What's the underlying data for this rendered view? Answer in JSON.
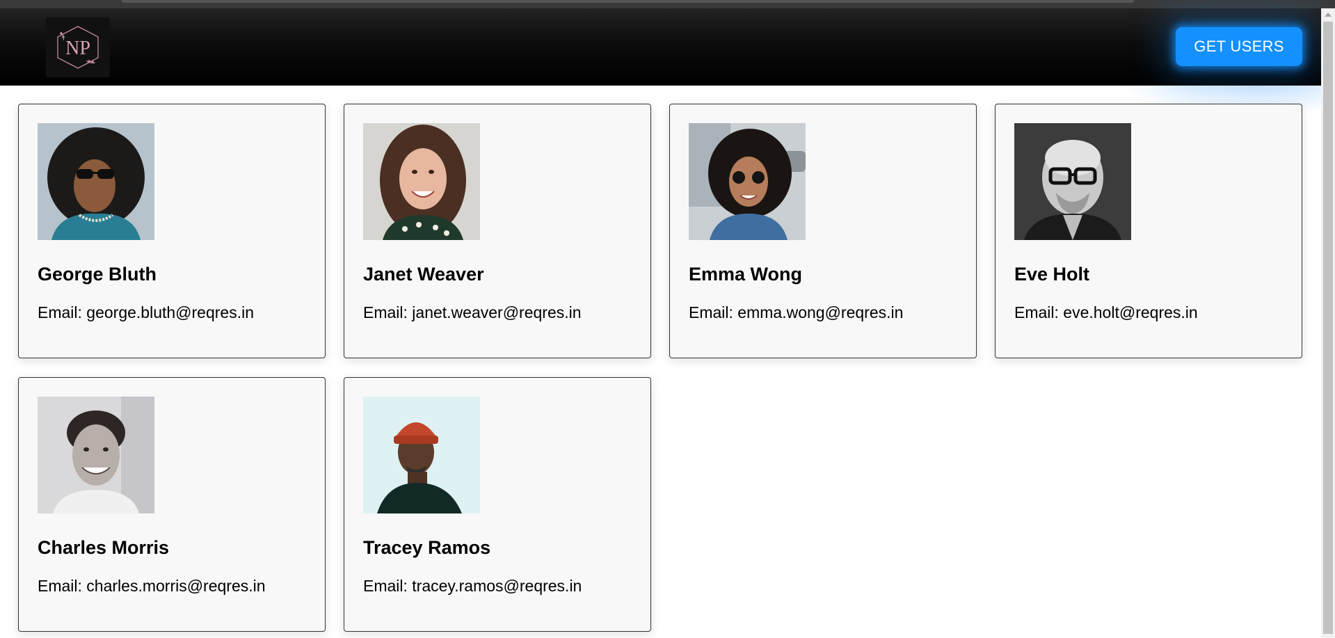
{
  "header": {
    "logo_text": "NP",
    "get_users_label": "GET USERS"
  },
  "email_prefix": "Email:",
  "users": [
    {
      "name": "George Bluth",
      "email": "george.bluth@reqres.in",
      "avatar_icon": "avatar-photo"
    },
    {
      "name": "Janet Weaver",
      "email": "janet.weaver@reqres.in",
      "avatar_icon": "avatar-photo"
    },
    {
      "name": "Emma Wong",
      "email": "emma.wong@reqres.in",
      "avatar_icon": "avatar-photo"
    },
    {
      "name": "Eve Holt",
      "email": "eve.holt@reqres.in",
      "avatar_icon": "avatar-photo"
    },
    {
      "name": "Charles Morris",
      "email": "charles.morris@reqres.in",
      "avatar_icon": "avatar-photo"
    },
    {
      "name": "Tracey Ramos",
      "email": "tracey.ramos@reqres.in",
      "avatar_icon": "avatar-photo"
    }
  ],
  "colors": {
    "accent": "#1490ff",
    "header_bg": "#000000",
    "card_bg": "#f8f8f8",
    "logo_mauve": "#c48a9a"
  }
}
